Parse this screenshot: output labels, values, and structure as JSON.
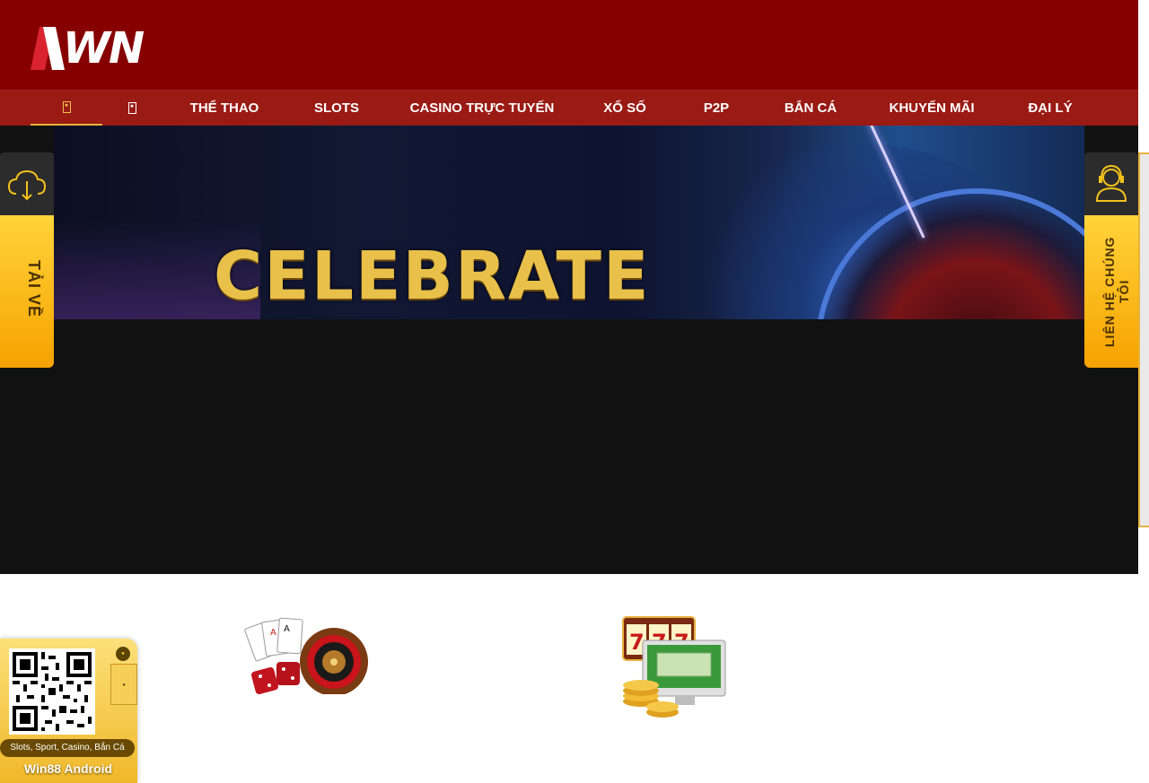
{
  "header": {
    "logo_text": "WN"
  },
  "nav": {
    "home_icon_glyph": "E 4\n0 4",
    "second_icon_glyph": "E 6\n0 3",
    "items": [
      {
        "label": "THỂ THAO"
      },
      {
        "label": "SLOTS"
      },
      {
        "label": "CASINO TRỰC TUYẾN"
      },
      {
        "label": "XỔ SỐ"
      },
      {
        "label": "P2P"
      },
      {
        "label": "BẮN CÁ"
      },
      {
        "label": "KHUYẾN MÃI"
      },
      {
        "label": "ĐẠI LÝ"
      }
    ]
  },
  "banner": {
    "title": "CELEBRATE"
  },
  "side_left": {
    "label": "TẢI VỀ"
  },
  "side_right": {
    "label": "LIÊN HỆ CHÚNG TÔI"
  },
  "qr_widget": {
    "badge_glyph": "E 3\n0 8",
    "side_glyph": "E 5\n0 5",
    "tagline": "Slots, Sport, Casino, Bắn Cá",
    "title": "Win88 Android"
  },
  "colors": {
    "header_bg": "#860002",
    "nav_bg": "#9a1a14",
    "accent_gold": "#f6b800"
  }
}
